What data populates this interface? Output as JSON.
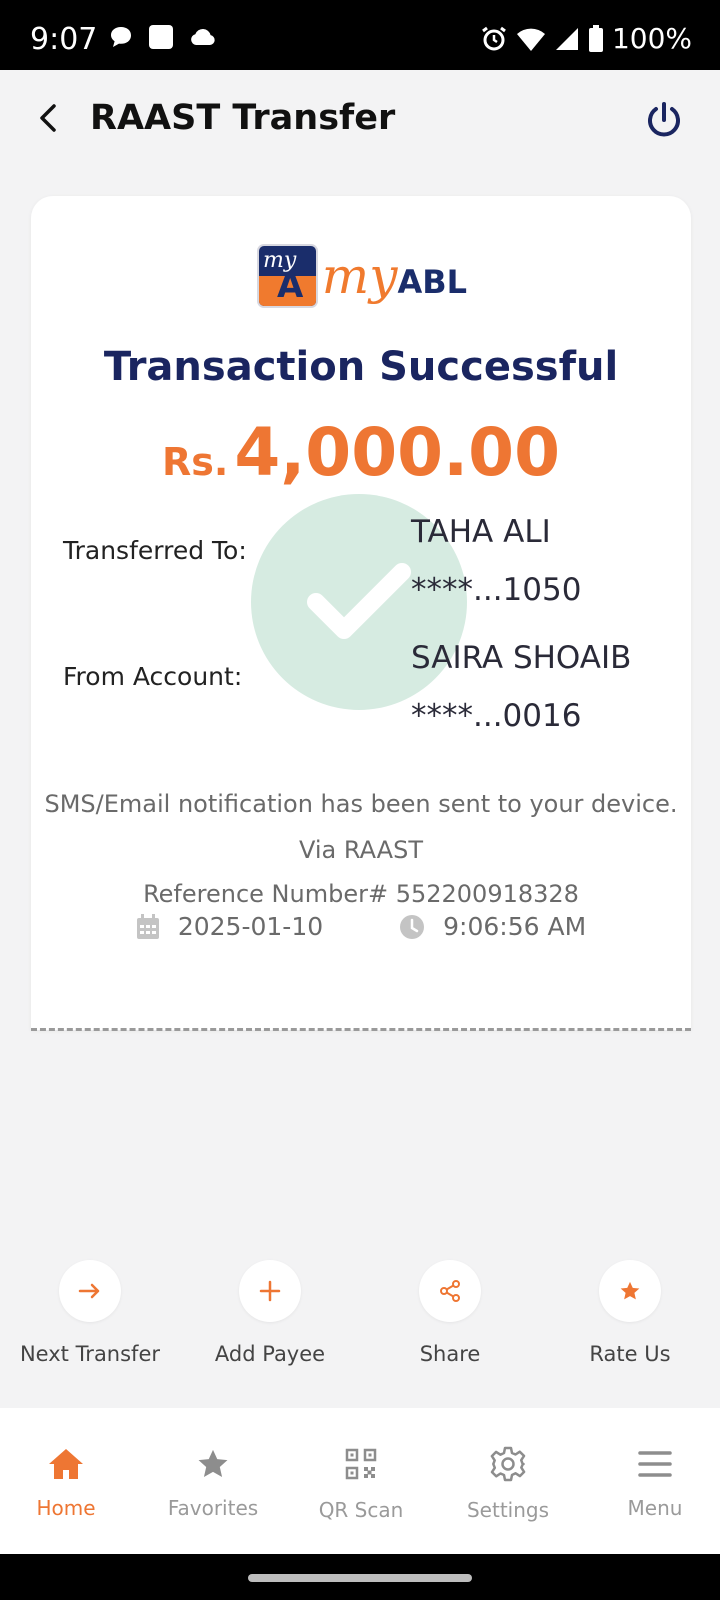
{
  "status_bar": {
    "time": "9:07",
    "battery": "100%"
  },
  "header": {
    "title": "RAAST Transfer"
  },
  "receipt": {
    "logo_text_my": "my",
    "logo_text_abl": "ABL",
    "status": "Transaction Successful",
    "currency": "Rs.",
    "amount": "4,000.00",
    "transferred_to_label": "Transferred To:",
    "transferred_to_name": "TAHA ALI",
    "transferred_to_account": "****...1050",
    "from_account_label": "From Account:",
    "from_account_name": "SAIRA SHOAIB",
    "from_account_number": "****...0016",
    "notification": "SMS/Email notification has been sent to your device.",
    "via": "Via RAAST",
    "reference": "Reference Number# 552200918328",
    "date": "2025-01-10",
    "time": "9:06:56 AM"
  },
  "quick_actions": [
    {
      "label": "Next Transfer",
      "icon": "arrow-right-icon"
    },
    {
      "label": "Add Payee",
      "icon": "plus-icon"
    },
    {
      "label": "Share",
      "icon": "share-icon"
    },
    {
      "label": "Rate Us",
      "icon": "star-icon"
    }
  ],
  "bottom_nav": [
    {
      "label": "Home",
      "icon": "home-icon",
      "active": true
    },
    {
      "label": "Favorites",
      "icon": "star-icon"
    },
    {
      "label": "QR Scan",
      "icon": "qr-icon"
    },
    {
      "label": "Settings",
      "icon": "gear-icon"
    },
    {
      "label": "Menu",
      "icon": "menu-icon"
    }
  ],
  "colors": {
    "accent": "#ee7633",
    "brand_navy": "#1a2560",
    "success_circle": "#d6ebe1"
  }
}
